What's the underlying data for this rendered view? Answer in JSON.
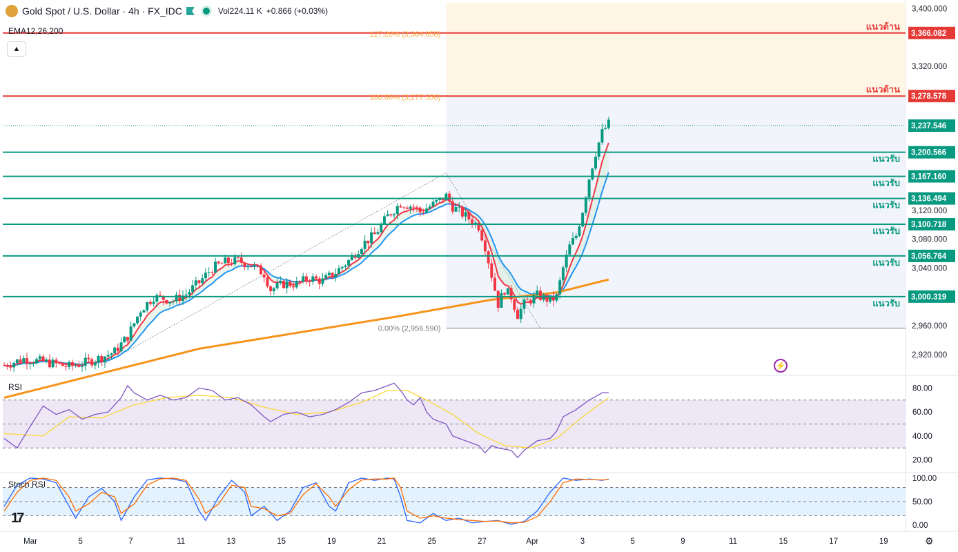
{
  "header": {
    "symbol": "Gold Spot / U.S. Dollar · 4h · FX_IDC",
    "volume": "Vol224.11 K",
    "change": "+0.866 (+0.03%)",
    "indicator": "EMA12,26,200",
    "rsi_label": "RSI",
    "stoch_label": "Stoch RSI"
  },
  "colors": {
    "up": "#089981",
    "down": "#f23645",
    "ema_fast": "#f23645",
    "ema_slow": "#2196f3",
    "ema200": "#f7931a",
    "support": "#089981",
    "resistance": "#e53935",
    "rsi": "#7e57c2",
    "rsi_ma": "#fdd835",
    "stoch_k": "#2962ff",
    "stoch_d": "#ff6d00"
  },
  "chart_data": {
    "type": "candlestick",
    "price_axis": {
      "min": 2892,
      "max": 3408,
      "ticks": [
        "3,400.000",
        "3,320.000",
        "3,120.000",
        "3,080.000",
        "3,040.000",
        "2,960.000",
        "2,920.000"
      ]
    },
    "time_axis": [
      "Mar",
      "5",
      "7",
      "11",
      "13",
      "15",
      "19",
      "21",
      "25",
      "27",
      "Apr",
      "3",
      "5",
      "9",
      "11",
      "15",
      "17",
      "19"
    ],
    "current_price": "3,237.546",
    "levels": [
      {
        "label": "แนวต้าน",
        "price": 3366.082,
        "text": "3,366.082",
        "kind": "resistance"
      },
      {
        "label": "แนวต้าน",
        "price": 3278.578,
        "text": "3,278.578",
        "kind": "resistance"
      },
      {
        "label": "แนวรับ",
        "price": 3200.566,
        "text": "3,200.566",
        "kind": "support"
      },
      {
        "label": "แนวรับ",
        "price": 3167.16,
        "text": "3,167.160",
        "kind": "support"
      },
      {
        "label": "แนวรับ",
        "price": 3136.494,
        "text": "3,136.494",
        "kind": "support"
      },
      {
        "label": "แนวรับ",
        "price": 3100.718,
        "text": "3,100.718",
        "kind": "support"
      },
      {
        "label": "แนวรับ",
        "price": 3056.764,
        "text": "3,056.764",
        "kind": "support"
      },
      {
        "label": "แนวรับ",
        "price": 3000.319,
        "text": "3,000.319",
        "kind": "support"
      }
    ],
    "fib": [
      {
        "label": "127.20% (3,364.858)",
        "price": 3364.858
      },
      {
        "label": "100.00% (3,277.550)",
        "price": 3277.55
      },
      {
        "label": "0.00% (2,956.590)",
        "price": 2956.59
      }
    ],
    "close_path": [
      [
        0,
        2905
      ],
      [
        6,
        2914
      ],
      [
        12,
        2910
      ],
      [
        20,
        2903
      ],
      [
        26,
        2910
      ],
      [
        30,
        2916
      ],
      [
        34,
        2924
      ],
      [
        38,
        2945
      ],
      [
        42,
        2982
      ],
      [
        46,
        3000
      ],
      [
        52,
        2995
      ],
      [
        56,
        3004
      ],
      [
        60,
        3020
      ],
      [
        64,
        3040
      ],
      [
        68,
        3048
      ],
      [
        72,
        3050
      ],
      [
        76,
        3044
      ],
      [
        80,
        3032
      ],
      [
        82,
        3010
      ],
      [
        86,
        3018
      ],
      [
        90,
        3018
      ],
      [
        94,
        3026
      ],
      [
        98,
        3022
      ],
      [
        102,
        3034
      ],
      [
        106,
        3050
      ],
      [
        110,
        3072
      ],
      [
        114,
        3086
      ],
      [
        118,
        3112
      ],
      [
        122,
        3130
      ],
      [
        126,
        3125
      ],
      [
        128,
        3118
      ],
      [
        132,
        3128
      ],
      [
        136,
        3140
      ],
      [
        138,
        3125
      ],
      [
        142,
        3112
      ],
      [
        146,
        3098
      ],
      [
        148,
        3070
      ],
      [
        150,
        3030
      ],
      [
        152,
        2990
      ],
      [
        154,
        3010
      ],
      [
        156,
        3000
      ],
      [
        158,
        2975
      ],
      [
        160,
        2990
      ],
      [
        164,
        3002
      ],
      [
        168,
        2995
      ],
      [
        170,
        3000
      ],
      [
        172,
        3040
      ],
      [
        174,
        3070
      ],
      [
        176,
        3085
      ],
      [
        178,
        3120
      ],
      [
        180,
        3165
      ],
      [
        182,
        3200
      ],
      [
        184,
        3228
      ],
      [
        186,
        3240
      ]
    ],
    "ema200_path": [
      [
        0,
        2860
      ],
      [
        60,
        2928
      ],
      [
        120,
        2972
      ],
      [
        150,
        2996
      ],
      [
        170,
        3006
      ],
      [
        186,
        3024
      ]
    ],
    "rsi": {
      "min": 10,
      "max": 90,
      "ticks": [
        "80.00",
        "60.00",
        "40.00",
        "20.00"
      ],
      "upper": 70,
      "lower": 30,
      "mid": 50,
      "values": [
        [
          0,
          38
        ],
        [
          4,
          30
        ],
        [
          8,
          48
        ],
        [
          12,
          65
        ],
        [
          16,
          58
        ],
        [
          20,
          62
        ],
        [
          24,
          54
        ],
        [
          28,
          58
        ],
        [
          32,
          60
        ],
        [
          36,
          72
        ],
        [
          38,
          82
        ],
        [
          40,
          76
        ],
        [
          44,
          70
        ],
        [
          48,
          74
        ],
        [
          52,
          70
        ],
        [
          56,
          72
        ],
        [
          60,
          80
        ],
        [
          64,
          78
        ],
        [
          68,
          70
        ],
        [
          72,
          72
        ],
        [
          76,
          66
        ],
        [
          80,
          56
        ],
        [
          82,
          52
        ],
        [
          86,
          58
        ],
        [
          90,
          60
        ],
        [
          94,
          56
        ],
        [
          98,
          58
        ],
        [
          102,
          62
        ],
        [
          106,
          68
        ],
        [
          110,
          76
        ],
        [
          114,
          78
        ],
        [
          118,
          82
        ],
        [
          120,
          84
        ],
        [
          122,
          78
        ],
        [
          124,
          70
        ],
        [
          126,
          66
        ],
        [
          128,
          72
        ],
        [
          130,
          60
        ],
        [
          132,
          54
        ],
        [
          136,
          50
        ],
        [
          138,
          40
        ],
        [
          142,
          36
        ],
        [
          146,
          32
        ],
        [
          148,
          26
        ],
        [
          150,
          32
        ],
        [
          152,
          30
        ],
        [
          156,
          28
        ],
        [
          158,
          22
        ],
        [
          160,
          28
        ],
        [
          164,
          36
        ],
        [
          168,
          38
        ],
        [
          170,
          44
        ],
        [
          172,
          56
        ],
        [
          176,
          62
        ],
        [
          180,
          70
        ],
        [
          184,
          76
        ],
        [
          186,
          76
        ]
      ],
      "ma_values": [
        [
          0,
          42
        ],
        [
          12,
          40
        ],
        [
          20,
          56
        ],
        [
          30,
          55
        ],
        [
          40,
          66
        ],
        [
          50,
          72
        ],
        [
          60,
          74
        ],
        [
          70,
          72
        ],
        [
          80,
          64
        ],
        [
          90,
          58
        ],
        [
          100,
          60
        ],
        [
          110,
          68
        ],
        [
          118,
          78
        ],
        [
          124,
          78
        ],
        [
          130,
          70
        ],
        [
          138,
          58
        ],
        [
          146,
          42
        ],
        [
          154,
          32
        ],
        [
          162,
          30
        ],
        [
          170,
          38
        ],
        [
          178,
          56
        ],
        [
          186,
          72
        ]
      ]
    },
    "stoch": {
      "min": -10,
      "max": 110,
      "ticks": [
        "100.00",
        "50.00",
        "0.00"
      ],
      "upper": 80,
      "lower": 20,
      "mid": 50,
      "k": [
        [
          0,
          40
        ],
        [
          4,
          85
        ],
        [
          8,
          100
        ],
        [
          12,
          98
        ],
        [
          16,
          90
        ],
        [
          20,
          40
        ],
        [
          22,
          15
        ],
        [
          26,
          60
        ],
        [
          30,
          78
        ],
        [
          34,
          50
        ],
        [
          36,
          10
        ],
        [
          40,
          60
        ],
        [
          44,
          96
        ],
        [
          48,
          100
        ],
        [
          52,
          98
        ],
        [
          56,
          92
        ],
        [
          60,
          30
        ],
        [
          62,
          10
        ],
        [
          66,
          60
        ],
        [
          70,
          95
        ],
        [
          74,
          70
        ],
        [
          76,
          20
        ],
        [
          80,
          40
        ],
        [
          84,
          10
        ],
        [
          88,
          30
        ],
        [
          92,
          80
        ],
        [
          96,
          90
        ],
        [
          100,
          40
        ],
        [
          102,
          30
        ],
        [
          106,
          90
        ],
        [
          110,
          100
        ],
        [
          114,
          95
        ],
        [
          118,
          100
        ],
        [
          120,
          98
        ],
        [
          122,
          60
        ],
        [
          124,
          10
        ],
        [
          128,
          5
        ],
        [
          132,
          25
        ],
        [
          136,
          10
        ],
        [
          140,
          15
        ],
        [
          144,
          5
        ],
        [
          148,
          8
        ],
        [
          152,
          10
        ],
        [
          156,
          2
        ],
        [
          160,
          8
        ],
        [
          164,
          30
        ],
        [
          168,
          70
        ],
        [
          172,
          100
        ],
        [
          176,
          95
        ],
        [
          180,
          98
        ],
        [
          184,
          95
        ],
        [
          186,
          98
        ]
      ],
      "d": [
        [
          0,
          30
        ],
        [
          4,
          70
        ],
        [
          8,
          95
        ],
        [
          12,
          100
        ],
        [
          16,
          95
        ],
        [
          20,
          60
        ],
        [
          22,
          30
        ],
        [
          26,
          45
        ],
        [
          30,
          70
        ],
        [
          34,
          60
        ],
        [
          36,
          25
        ],
        [
          40,
          45
        ],
        [
          44,
          85
        ],
        [
          48,
          98
        ],
        [
          52,
          100
        ],
        [
          56,
          95
        ],
        [
          60,
          55
        ],
        [
          62,
          25
        ],
        [
          66,
          45
        ],
        [
          70,
          85
        ],
        [
          74,
          80
        ],
        [
          76,
          40
        ],
        [
          80,
          35
        ],
        [
          84,
          20
        ],
        [
          88,
          25
        ],
        [
          92,
          65
        ],
        [
          96,
          88
        ],
        [
          100,
          60
        ],
        [
          102,
          40
        ],
        [
          106,
          75
        ],
        [
          110,
          96
        ],
        [
          114,
          98
        ],
        [
          118,
          98
        ],
        [
          120,
          100
        ],
        [
          122,
          80
        ],
        [
          124,
          30
        ],
        [
          128,
          15
        ],
        [
          132,
          20
        ],
        [
          136,
          15
        ],
        [
          140,
          12
        ],
        [
          144,
          10
        ],
        [
          148,
          8
        ],
        [
          152,
          9
        ],
        [
          156,
          5
        ],
        [
          160,
          6
        ],
        [
          164,
          18
        ],
        [
          168,
          50
        ],
        [
          172,
          90
        ],
        [
          176,
          98
        ],
        [
          180,
          97
        ],
        [
          184,
          96
        ],
        [
          186,
          97
        ]
      ]
    }
  }
}
